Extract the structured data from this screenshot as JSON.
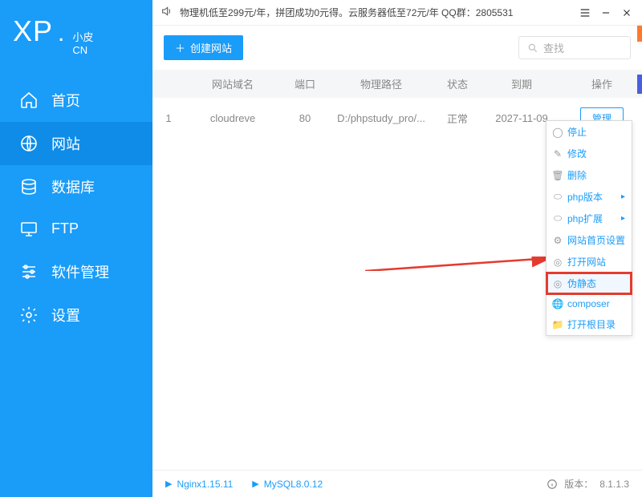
{
  "logo": {
    "xp": "XP",
    "dot": ".",
    "cn_top": "小皮",
    "cn_bot": "CN"
  },
  "titlebar": {
    "promo": "物理机低至299元/年，拼团成功0元得。云服务器低至72元/年  QQ群：2805531"
  },
  "sidebar": {
    "items": [
      {
        "label": "首页",
        "icon": "home"
      },
      {
        "label": "网站",
        "icon": "globe"
      },
      {
        "label": "数据库",
        "icon": "database"
      },
      {
        "label": "FTP",
        "icon": "monitor"
      },
      {
        "label": "软件管理",
        "icon": "sliders"
      },
      {
        "label": "设置",
        "icon": "gear"
      }
    ]
  },
  "toolbar": {
    "create": "创建网站",
    "search_placeholder": "查找"
  },
  "table": {
    "headers": {
      "domain": "网站域名",
      "port": "端口",
      "path": "物理路径",
      "status": "状态",
      "expire": "到期",
      "action": "操作"
    },
    "rows": [
      {
        "idx": "1",
        "domain": "cloudreve",
        "port": "80",
        "path": "D:/phpstudy_pro/...",
        "status": "正常",
        "expire": "2027-11-09",
        "action": "管理"
      }
    ]
  },
  "dropdown": {
    "items": [
      {
        "label": "停止",
        "icon": "stop"
      },
      {
        "label": "修改",
        "icon": "edit"
      },
      {
        "label": "删除",
        "icon": "trash"
      },
      {
        "label": "php版本",
        "icon": "php",
        "sub": true
      },
      {
        "label": "php扩展",
        "icon": "php",
        "sub": true
      },
      {
        "label": "网站首页设置",
        "icon": "cog"
      },
      {
        "label": "打开网站",
        "icon": "target"
      },
      {
        "label": "伪静态",
        "icon": "target",
        "highlight": true
      },
      {
        "label": "composer",
        "icon": "globe2"
      },
      {
        "label": "打开根目录",
        "icon": "folder"
      }
    ]
  },
  "statusbar": {
    "nginx": "Nginx1.15.11",
    "mysql": "MySQL8.0.12",
    "version_label": "版本：",
    "version": "8.1.1.3"
  }
}
